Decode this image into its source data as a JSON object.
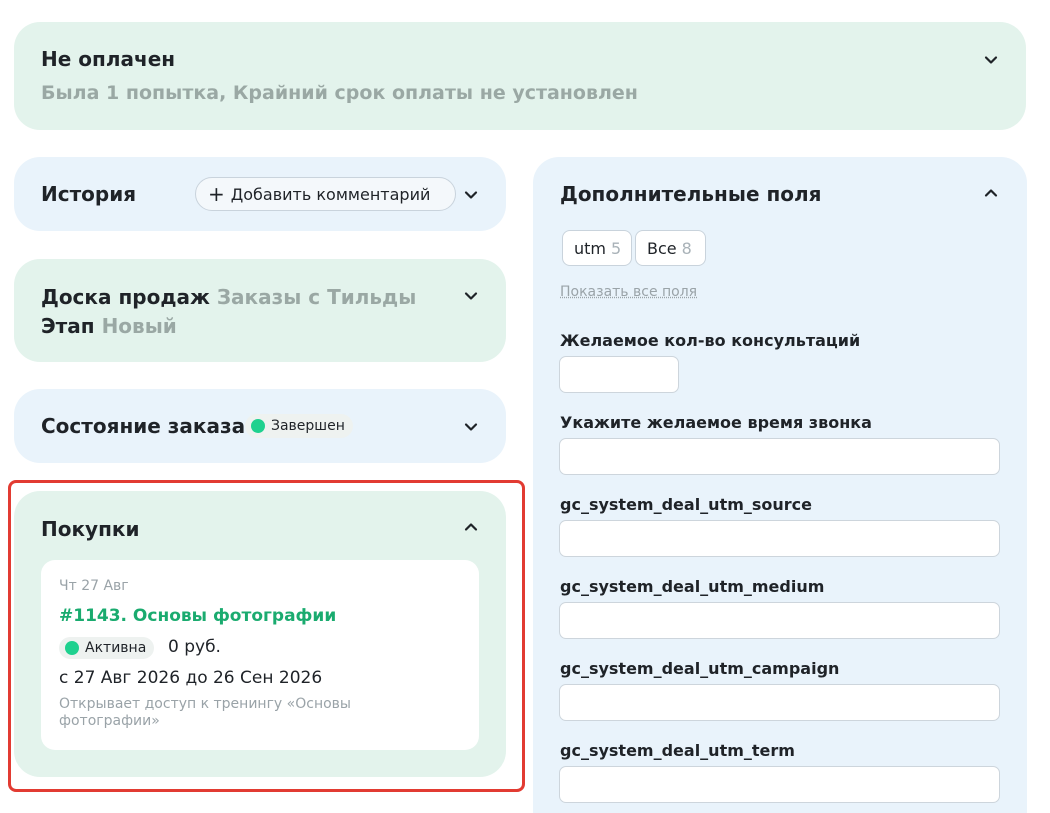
{
  "payment": {
    "status": "Не оплачен",
    "details": "Была 1 попытка, Крайний срок оплаты не установлен"
  },
  "history": {
    "title": "История",
    "add_comment": "Добавить комментарий"
  },
  "board": {
    "label1": "Доска продаж",
    "value1": "Заказы с Тильды",
    "label2": "Этап",
    "value2": "Новый"
  },
  "order_state": {
    "title": "Состояние заказа",
    "badge": "Завершен"
  },
  "purchases": {
    "title": "Покупки",
    "item": {
      "date": "Чт 27 Авг",
      "order": "#1143. Основы фотографии",
      "status": "Активна",
      "price": "0 руб.",
      "range": "с 27 Авг 2026 до 26 Сен 2026",
      "description": "Открывает доступ к тренингу «Основы фотографии»"
    }
  },
  "extra_fields": {
    "title": "Дополнительные поля",
    "filters": [
      {
        "label": "utm",
        "count": "5"
      },
      {
        "label": "Все",
        "count": "8"
      }
    ],
    "show_all": "Показать все поля",
    "fields": [
      {
        "label": "Желаемое кол-во консультаций",
        "value": ""
      },
      {
        "label": "Укажите желаемое время звонка",
        "value": ""
      },
      {
        "label": "gc_system_deal_utm_source",
        "value": ""
      },
      {
        "label": "gc_system_deal_utm_medium",
        "value": ""
      },
      {
        "label": "gc_system_deal_utm_campaign",
        "value": ""
      },
      {
        "label": "gc_system_deal_utm_term",
        "value": ""
      }
    ]
  },
  "colors": {
    "accent_green": "#1aab6f",
    "status_dot": "#1fd18f",
    "highlight": "#e23b32"
  }
}
